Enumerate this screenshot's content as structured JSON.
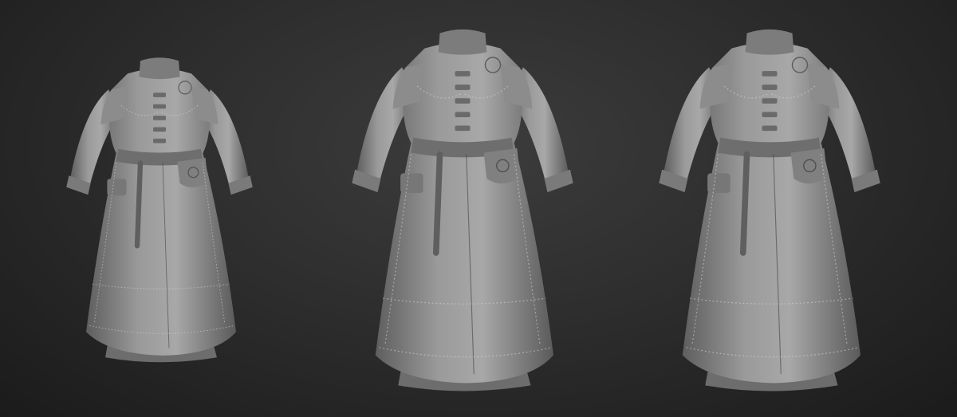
{
  "scene": {
    "background_top": "#3c3c3c",
    "background_bottom": "#1b1b1b",
    "material_color": "#8e8e8e",
    "views": [
      {
        "name": "three-quarter-view"
      },
      {
        "name": "front-view"
      },
      {
        "name": "front-right-view"
      }
    ]
  }
}
